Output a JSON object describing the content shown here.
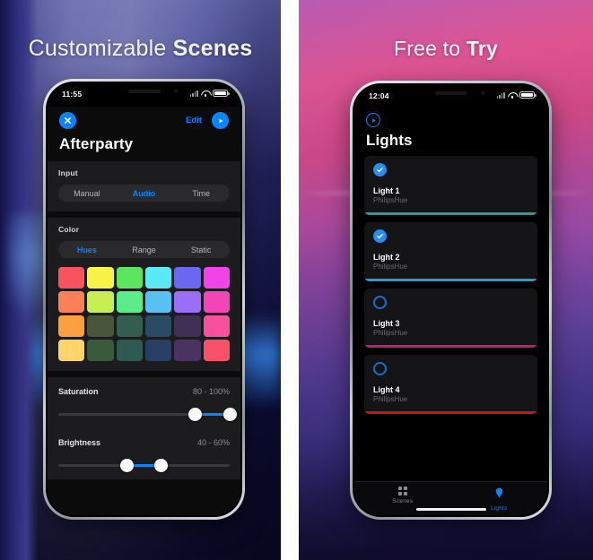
{
  "left_panel": {
    "headline": {
      "light": "Customizable",
      "bold": "Scenes"
    },
    "accent_color": "#0a84ff",
    "status_bar": {
      "time": "11:55",
      "wifi_icon": "wifi-icon",
      "battery_icon": "battery-icon",
      "signal_icon": "signal-icon"
    },
    "nav": {
      "close_icon": "close-icon",
      "edit_label": "Edit",
      "play_icon": "play-icon"
    },
    "scene_title": "Afterparty",
    "input_section": {
      "label": "Input",
      "options": [
        "Manual",
        "Audio",
        "Time"
      ],
      "selected": "Audio"
    },
    "color_section": {
      "label": "Color",
      "options": [
        "Hues",
        "Range",
        "Static"
      ],
      "selected": "Hues",
      "swatches": [
        [
          "#f9535f",
          "#f7f347",
          "#5ce55e",
          "#5ce9f7",
          "#6b67f0",
          "#f044e8"
        ],
        [
          "#fa8059",
          "#c7ef54",
          "#5ceb8a",
          "#59c0f2",
          "#9a6ef7",
          "#f246b8"
        ],
        [
          "#fb9f3f",
          "#47553a",
          "#335d4e",
          "#2b4a63",
          "#3f2f55",
          "#f7509e"
        ],
        [
          "#ffd46b",
          "#3b5a3c",
          "#2f5a51",
          "#283f63",
          "#4a3360",
          "#f85169"
        ]
      ]
    },
    "saturation": {
      "label": "Saturation",
      "value": "80 - 100%",
      "low_pct": 80,
      "high_pct": 100
    },
    "brightness": {
      "label": "Brightness",
      "value": "40 - 60%",
      "low_pct": 40,
      "high_pct": 60
    }
  },
  "right_panel": {
    "headline": {
      "light": "Free to",
      "bold": "Try"
    },
    "accent_color": "#0a84ff",
    "status_bar": {
      "time": "12:04",
      "wifi_icon": "wifi-icon",
      "battery_icon": "battery-icon",
      "signal_icon": "signal-icon"
    },
    "brand_icon": "compass-play-icon",
    "title": "Lights",
    "lights": [
      {
        "name": "Light 1",
        "subtitle": "PhilipsHue",
        "selected": true,
        "bar_color": "#18a39b"
      },
      {
        "name": "Light 2",
        "subtitle": "PhilipsHue",
        "selected": true,
        "bar_color": "#1d9ed4"
      },
      {
        "name": "Light 3",
        "subtitle": "PhilipsHue",
        "selected": false,
        "bar_color": "#c01e74"
      },
      {
        "name": "Light 4",
        "subtitle": "PhilipsHue",
        "selected": false,
        "bar_color": "#cc1414"
      }
    ],
    "tabs": [
      {
        "label": "Scenes",
        "icon": "grid-icon",
        "active": false
      },
      {
        "label": "Lights",
        "icon": "bulb-icon",
        "active": true
      }
    ]
  }
}
